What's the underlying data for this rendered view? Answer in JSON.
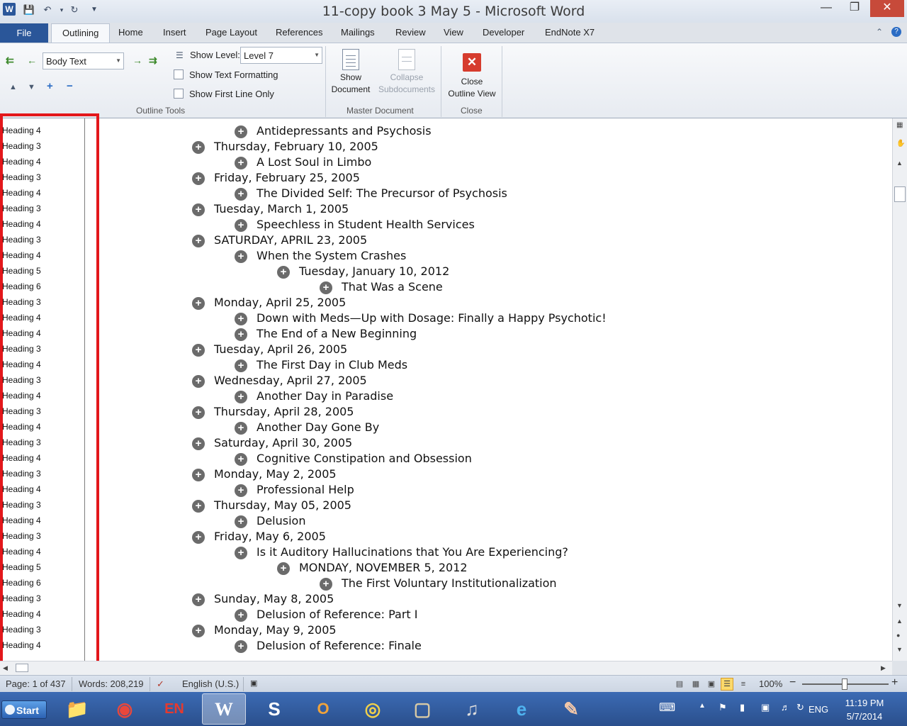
{
  "window": {
    "title": "11-copy book 3 May 5 - Microsoft Word",
    "app_icon": "W",
    "minimize_glyph": "—",
    "maximize_glyph": "❐",
    "close_glyph": "✕"
  },
  "ribbon_tabs": [
    "File",
    "Outlining",
    "Home",
    "Insert",
    "Page Layout",
    "References",
    "Mailings",
    "Review",
    "View",
    "Developer",
    "EndNote X7"
  ],
  "outline_tools": {
    "level_combo": "Body Text",
    "show_level_label": "Show Level:",
    "show_level_value": "Level 7",
    "show_text_formatting": "Show Text Formatting",
    "show_first_line_only": "Show First Line Only",
    "group_label": "Outline Tools"
  },
  "master_document": {
    "show_document_line1": "Show",
    "show_document_line2": "Document",
    "collapse_line1": "Collapse",
    "collapse_line2": "Subdocuments",
    "group_label": "Master Document"
  },
  "close_group": {
    "close_line1": "Close",
    "close_line2": "Outline View",
    "group_label": "Close"
  },
  "style_pane": [
    "Heading 4",
    "Heading 3",
    "Heading 4",
    "Heading 3",
    "Heading 4",
    "Heading 3",
    "Heading 4",
    "Heading 3",
    "Heading 4",
    "Heading 5",
    "Heading 6",
    "Heading 3",
    "Heading 4",
    "Heading 4",
    "Heading 3",
    "Heading 4",
    "Heading 3",
    "Heading 4",
    "Heading 3",
    "Heading 4",
    "Heading 3",
    "Heading 4",
    "Heading 3",
    "Heading 4",
    "Heading 3",
    "Heading 4",
    "Heading 3",
    "Heading 4",
    "Heading 5",
    "Heading 6",
    "Heading 3",
    "Heading 4",
    "Heading 3",
    "Heading 4"
  ],
  "outline": [
    {
      "level": 2,
      "text": "Antidepressants and Psychosis"
    },
    {
      "level": 1,
      "text": "Thursday, February 10, 2005"
    },
    {
      "level": 2,
      "text": "A Lost Soul in Limbo"
    },
    {
      "level": 1,
      "text": "Friday, February 25, 2005"
    },
    {
      "level": 2,
      "text": "The Divided Self: The Precursor of Psychosis"
    },
    {
      "level": 1,
      "text": "Tuesday, March 1, 2005"
    },
    {
      "level": 2,
      "text": "Speechless in Student Health Services"
    },
    {
      "level": 1,
      "text": "SATURDAY, APRIL 23, 2005"
    },
    {
      "level": 2,
      "text": "When the System Crashes"
    },
    {
      "level": 3,
      "text": "Tuesday, January 10, 2012"
    },
    {
      "level": 4,
      "text": "That Was a Scene"
    },
    {
      "level": 1,
      "text": "Monday, April 25, 2005"
    },
    {
      "level": 2,
      "text": "Down with Meds—Up with Dosage: Finally a Happy Psychotic!"
    },
    {
      "level": 2,
      "text": "The End of a New Beginning"
    },
    {
      "level": 1,
      "text": "Tuesday, April 26, 2005"
    },
    {
      "level": 2,
      "text": "The First Day in Club Meds"
    },
    {
      "level": 1,
      "text": "Wednesday, April 27, 2005"
    },
    {
      "level": 2,
      "text": "Another Day in Paradise"
    },
    {
      "level": 1,
      "text": "Thursday, April 28, 2005"
    },
    {
      "level": 2,
      "text": "Another Day Gone By"
    },
    {
      "level": 1,
      "text": "Saturday, April 30, 2005"
    },
    {
      "level": 2,
      "text": "Cognitive Constipation and Obsession"
    },
    {
      "level": 1,
      "text": "Monday, May 2, 2005"
    },
    {
      "level": 2,
      "text": "Professional Help"
    },
    {
      "level": 1,
      "text": "Thursday, May 05, 2005"
    },
    {
      "level": 2,
      "text": "Delusion"
    },
    {
      "level": 1,
      "text": "Friday, May 6, 2005"
    },
    {
      "level": 2,
      "text": "Is it Auditory Hallucinations that You Are Experiencing?"
    },
    {
      "level": 3,
      "text": "MONDAY, NOVEMBER 5, 2012"
    },
    {
      "level": 4,
      "text": "The First Voluntary Institutionalization"
    },
    {
      "level": 1,
      "text": "Sunday, May 8, 2005"
    },
    {
      "level": 2,
      "text": "Delusion of Reference: Part I"
    },
    {
      "level": 1,
      "text": "Monday, May 9, 2005"
    },
    {
      "level": 2,
      "text": "Delusion of Reference: Finale"
    }
  ],
  "status": {
    "page": "Page: 1 of 437",
    "words": "Words: 208,219",
    "language": "English (U.S.)",
    "zoom": "100%",
    "zoom_minus": "−",
    "zoom_plus": "+"
  },
  "taskbar": {
    "start": "Start",
    "language": "ENG",
    "time": "11:19 PM",
    "date": "5/7/2014"
  }
}
